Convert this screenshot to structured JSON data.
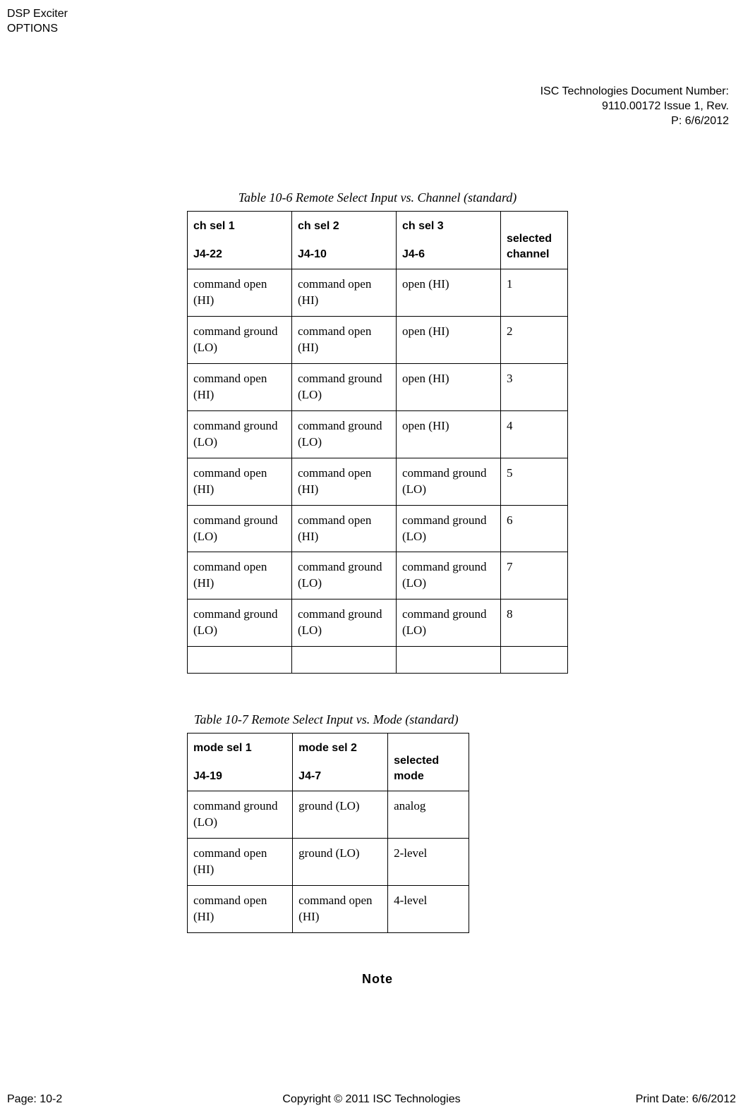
{
  "header": {
    "line1": "DSP Exciter",
    "line2": "OPTIONS"
  },
  "doc_info": {
    "line1": "ISC Technologies Document Number:",
    "line2": "9110.00172 Issue 1, Rev.",
    "line3": "P: 6/6/2012"
  },
  "table1": {
    "caption": "Table 10-6 Remote Select Input vs. Channel (standard)",
    "headers": [
      {
        "top": "ch sel 1",
        "bottom": "J4-22"
      },
      {
        "top": "ch sel 2",
        "bottom": "J4-10"
      },
      {
        "top": "ch sel 3",
        "bottom": "J4-6"
      },
      {
        "top": "",
        "bottom": "selected channel"
      }
    ],
    "rows": [
      [
        "command open (HI)",
        "command open (HI)",
        "open (HI)",
        "1"
      ],
      [
        "command ground (LO)",
        "command open (HI)",
        "open (HI)",
        "2"
      ],
      [
        "command open (HI)",
        "command ground (LO)",
        "open (HI)",
        "3"
      ],
      [
        "command ground (LO)",
        "command ground (LO)",
        "open (HI)",
        "4"
      ],
      [
        "command open (HI)",
        "command open (HI)",
        "command ground (LO)",
        "5"
      ],
      [
        "command ground (LO)",
        "command open (HI)",
        "command ground (LO)",
        "6"
      ],
      [
        "command open (HI)",
        "command ground (LO)",
        "command ground (LO)",
        "7"
      ],
      [
        "command ground (LO)",
        "command ground (LO)",
        "command ground (LO)",
        "8"
      ]
    ]
  },
  "table2": {
    "caption": "Table 10-7 Remote Select Input vs. Mode (standard)",
    "headers": [
      {
        "top": "mode sel 1",
        "bottom": "J4-19"
      },
      {
        "top": "mode sel 2",
        "bottom": "J4-7"
      },
      {
        "top": "",
        "bottom": "selected mode"
      }
    ],
    "rows": [
      [
        "command ground (LO)",
        "ground (LO)",
        "analog"
      ],
      [
        "command open (HI)",
        "ground (LO)",
        "2-level"
      ],
      [
        "command open (HI)",
        "command open (HI)",
        "4-level"
      ]
    ]
  },
  "note": "Note",
  "footer": {
    "left": "Page: 10-2",
    "center": "Copyright © 2011 ISC Technologies",
    "right": "Print Date: 6/6/2012"
  }
}
